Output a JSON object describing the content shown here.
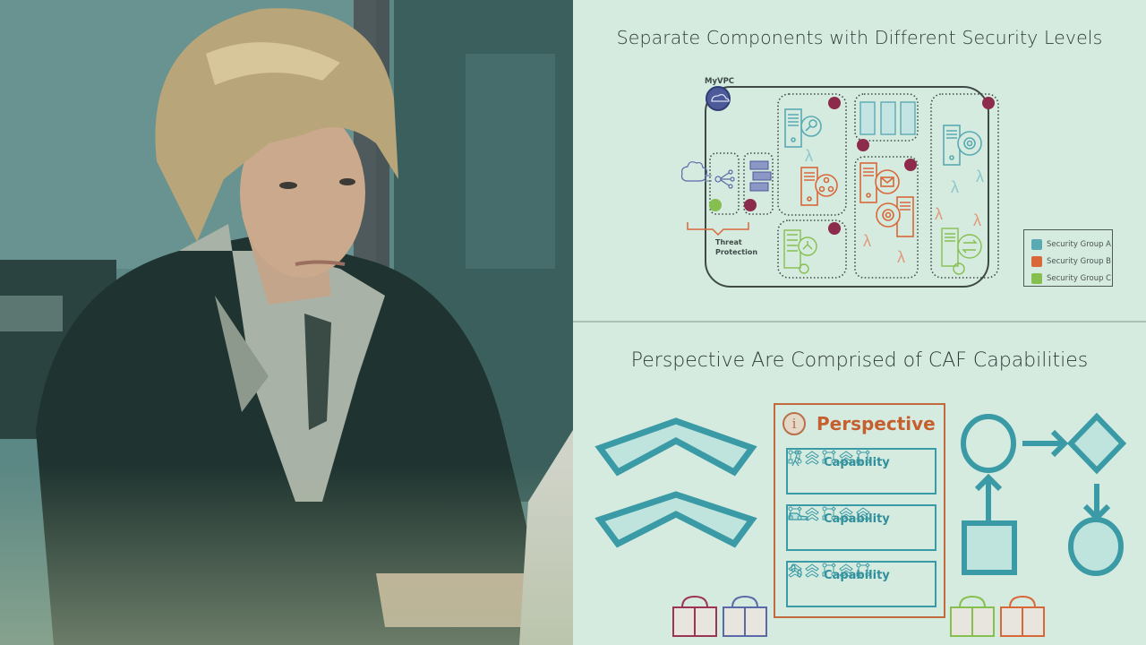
{
  "photo": {
    "description": "Woman with short blonde hair in dark blazer working on a laptop"
  },
  "slide_top": {
    "title": "Separate Components with Different Security Levels",
    "vpc_label": "MyVPC",
    "threat_label_line1": "Threat",
    "threat_label_line2": "Protection",
    "legend": [
      {
        "label": "Security Group A",
        "color": "#5aaab4"
      },
      {
        "label": "Security Group B",
        "color": "#d8683a"
      },
      {
        "label": "Security Group C",
        "color": "#86bf4f"
      }
    ],
    "colors": {
      "group_a": "#5aaab4",
      "group_b": "#d8683a",
      "group_c": "#86bf4f",
      "lock": "#8c2b4c",
      "vpc": "#4c5a9a",
      "outline": "#3f4a46"
    }
  },
  "slide_bottom": {
    "title": "Perspective Are Comprised of CAF Capabilities",
    "perspective": {
      "title": "Perspective",
      "icon": "info-icon",
      "info_glyph": "i",
      "capabilities": [
        {
          "label": "Capability",
          "icon": "walking-person-icon",
          "glyphs": [
            "flow",
            "chevrons",
            "flow",
            "chevrons",
            "flow"
          ]
        },
        {
          "label": "Capability",
          "icon": "shoe-icon",
          "glyphs": [
            "flow",
            "chevrons",
            "flow",
            "chevrons",
            "chevrons"
          ]
        },
        {
          "label": "Capability",
          "icon": "footprints-icon",
          "glyphs": [
            "chevrons",
            "chevrons",
            "flow",
            "chevrons",
            "flow"
          ]
        }
      ]
    },
    "colors": {
      "teal": "#3a9aa5",
      "teal_fill": "#bfe3dd",
      "orange": "#c65f2f",
      "reader_colors": [
        "#9b3553",
        "#5a6aa8",
        "#86bf4f",
        "#d8683a"
      ]
    }
  }
}
